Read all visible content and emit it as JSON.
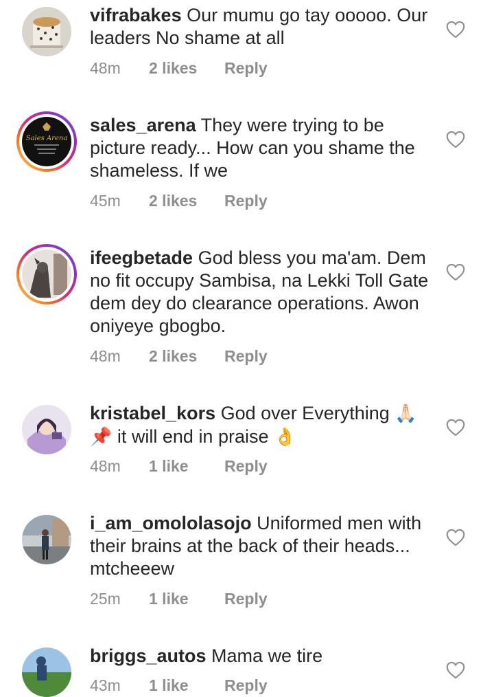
{
  "comments": [
    {
      "username": "vifrabakes",
      "text": "Our mumu go tay ooooo. Our leaders  No shame at all",
      "time": "48m",
      "likes": "2 likes",
      "reply": "Reply",
      "avatar_icon": "cake-avatar-icon"
    },
    {
      "username": "sales_arena",
      "text": "They were trying to be picture ready... How can you shame the shameless. If we",
      "time": "45m",
      "likes": "2 likes",
      "reply": "Reply",
      "avatar_icon": "sales-arena-logo-icon"
    },
    {
      "username": "ifeegbetade",
      "text": "God bless you ma'am. Dem no fit occupy Sambisa, na Lekki Toll Gate dem dey do clearance operations. Awon oniyeye gbogbo.",
      "time": "48m",
      "likes": "2 likes",
      "reply": "Reply",
      "avatar_icon": "gargoyle-avatar-icon"
    },
    {
      "username": "kristabel_kors",
      "text_line1": "God over Everything",
      "emoji1": "🙏🏻",
      "emoji2": "📌",
      "text_line2": "it will end in praise",
      "emoji3": "👌",
      "time": "48m",
      "likes": "1 like",
      "reply": "Reply",
      "avatar_icon": "anime-avatar-icon"
    },
    {
      "username": "i_am_omololasojo",
      "text": "Uniformed men with their brains at the back of their heads... mtcheeew",
      "time": "25m",
      "likes": "1 like",
      "reply": "Reply",
      "avatar_icon": "person-standing-avatar-icon"
    },
    {
      "username": "briggs_autos",
      "text": "Mama we tire",
      "time": "43m",
      "likes": "1 like",
      "reply": "Reply",
      "avatar_icon": "golf-avatar-icon"
    }
  ]
}
